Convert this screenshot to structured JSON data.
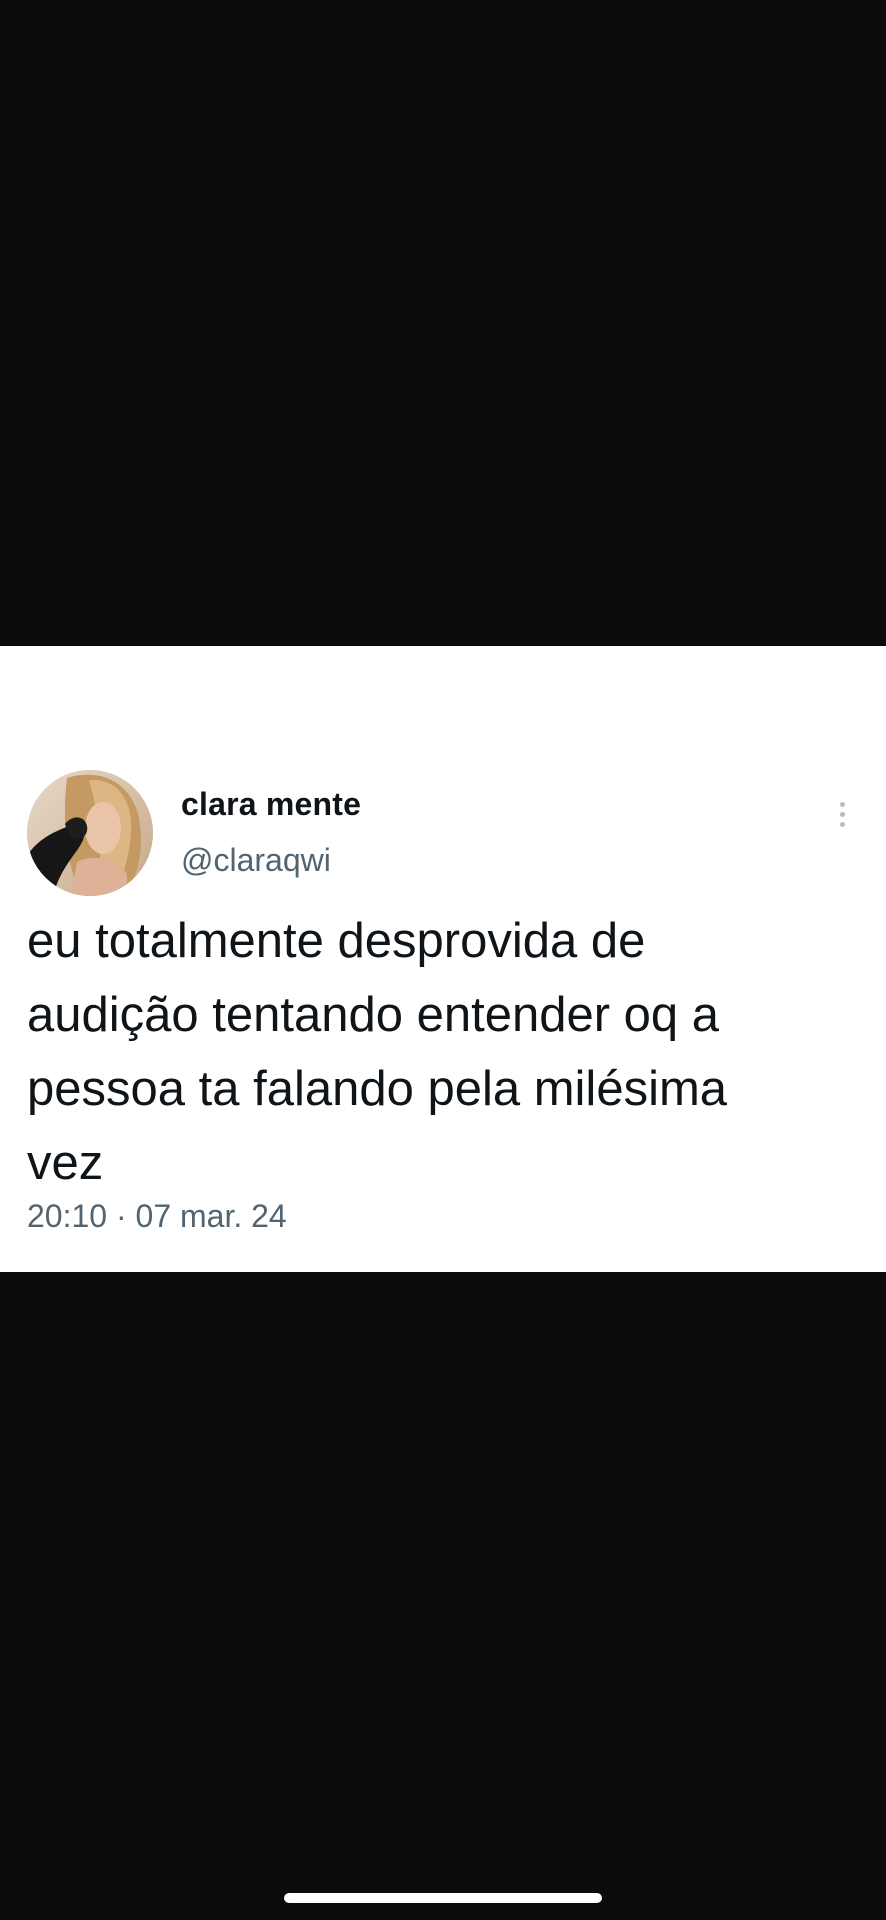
{
  "tweet": {
    "display_name": "clara mente",
    "handle": "@claraqwi",
    "text": "eu totalmente desprovida de\naudição tentando entender oq a\npessoa ta falando pela milésima\nvez",
    "timestamp": "20:10 · 07 mar. 24",
    "avatar": "profile-photo",
    "more_icon": "more-vertical-icon"
  },
  "colors": {
    "background": "#0b0b0c",
    "card": "#ffffff",
    "text_primary": "#0f1419",
    "text_secondary": "#536471"
  }
}
